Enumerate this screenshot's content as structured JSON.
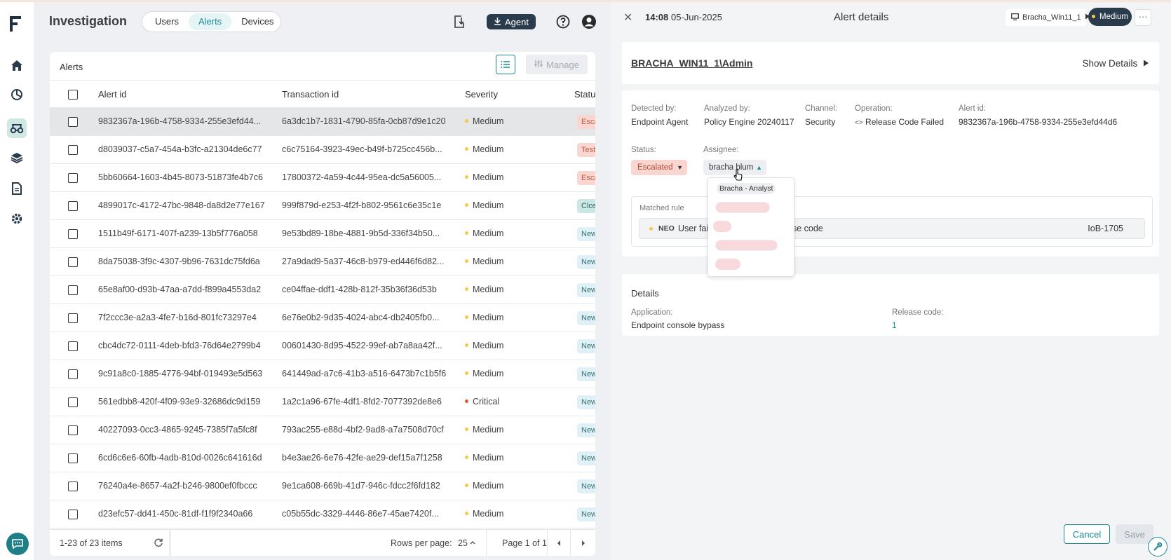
{
  "header": {
    "title": "Investigation",
    "tabs": [
      "Users",
      "Alerts",
      "Devices"
    ],
    "active_tab": "Alerts",
    "agent_label": "Agent"
  },
  "nav": {
    "icons": [
      "logo-icon",
      "home-icon",
      "pie-chart-icon",
      "investigation-icon",
      "layers-icon",
      "document-icon",
      "gear-icon",
      "chat-icon"
    ],
    "active": "investigation-icon"
  },
  "alerts": {
    "title": "Alerts",
    "manage_label": "Manage",
    "columns": [
      "Alert id",
      "Transaction id",
      "Severity",
      "Status"
    ],
    "rows": [
      {
        "alert_id": "9832367a-196b-4758-9334-255e3efd44...",
        "transaction_id": "6a3dc1b7-1831-4790-85fa-0cb87d9e1c20",
        "severity": "Medium",
        "status": "Escalated"
      },
      {
        "alert_id": "d8039037-c5a7-454a-b3fc-a21304de6c77",
        "transaction_id": "c6c75164-3923-49ec-b49f-b725cc456b...",
        "severity": "Medium",
        "status": "Testing"
      },
      {
        "alert_id": "5bb60664-1603-4b45-8073-51873fe4b7c6",
        "transaction_id": "17800372-4a59-4c44-95ea-dc5a56005...",
        "severity": "Medium",
        "status": "Escalated"
      },
      {
        "alert_id": "4899017c-4172-47bc-9848-da8d2e77e167",
        "transaction_id": "999f879d-e253-4f2f-b802-9561c6e35c1e",
        "severity": "Medium",
        "status": "Closed"
      },
      {
        "alert_id": "1511b49f-6171-407f-a239-13b5f776a058",
        "transaction_id": "9e53bd89-18be-4881-9b5d-336f34b50...",
        "severity": "Medium",
        "status": "New"
      },
      {
        "alert_id": "8da75038-3f9c-4307-9b96-7631dc75fd6a",
        "transaction_id": "27a9dad9-5a37-46c8-b979-ed446f6d82...",
        "severity": "Medium",
        "status": "New"
      },
      {
        "alert_id": "65e8af00-d93b-47aa-a7dd-f899a4553da2",
        "transaction_id": "ce04ffae-ddf1-428b-812f-35b36f36d53b",
        "severity": "Medium",
        "status": "New"
      },
      {
        "alert_id": "7f2ccc3e-a2a3-4fe7-b16d-801fc73297e4",
        "transaction_id": "6e76e0b2-9d35-4024-abc4-db2405fb0...",
        "severity": "Medium",
        "status": "New"
      },
      {
        "alert_id": "cbc4dc72-0111-4deb-bfd3-76d64e2799b4",
        "transaction_id": "00601430-8d95-4522-99ef-ab7a8aa42f...",
        "severity": "Medium",
        "status": "New"
      },
      {
        "alert_id": "9c91a8c0-1885-4776-94bf-019493e5d563",
        "transaction_id": "641449ad-a7c6-41b3-a516-6473b7c1b5f6",
        "severity": "Medium",
        "status": "New"
      },
      {
        "alert_id": "561edbb8-420f-4f09-93e9-32686dc9d159",
        "transaction_id": "1a2c1a96-67fe-4df1-8fd2-7077392de8e6",
        "severity": "Critical",
        "status": "New"
      },
      {
        "alert_id": "40227093-0cc3-4865-9245-7385f7a5fc8f",
        "transaction_id": "793ac255-e88d-4bf2-9ad8-a7a7508d70cf",
        "severity": "Medium",
        "status": "New"
      },
      {
        "alert_id": "6cd6c6e6-60fb-4adb-810d-0026c641616d",
        "transaction_id": "b4e3ae26-6e76-42fe-ae29-def15a7f1258",
        "severity": "Medium",
        "status": "New"
      },
      {
        "alert_id": "76240a4e-8657-4a2f-b246-9800ef0fbccc",
        "transaction_id": "9e1ca608-669b-41d7-946c-fdcc2f6fd182",
        "severity": "Medium",
        "status": "New"
      },
      {
        "alert_id": "d23efc57-dd41-450c-81df-f1f9f2340a66",
        "transaction_id": "c05b55dc-3329-4446-86e7-45ae7420f...",
        "severity": "Medium",
        "status": "New"
      }
    ],
    "selected_index": 0,
    "footer": {
      "range": "1-23 of 23 items",
      "rows_per_page_label": "Rows per page:",
      "rows_per_page": "25",
      "page": "Page 1 of 1"
    }
  },
  "detail": {
    "time": "14:08",
    "date": "05-Jun-2025",
    "title": "Alert details",
    "device": "Bracha_Win11_1",
    "severity": "Medium",
    "user": "BRACHA_WIN11_1\\Admin",
    "show_details": "Show Details",
    "fields": {
      "detected_by_label": "Detected by:",
      "detected_by": "Endpoint Agent",
      "analyzed_by_label": "Analyzed by:",
      "analyzed_by": "Policy Engine 20240117",
      "channel_label": "Channel:",
      "channel": "Security",
      "operation_label": "Operation:",
      "operation": "Release Code Failed",
      "alert_id_label": "Alert id:",
      "alert_id": "9832367a-196b-4758-9334-255e3efd44d6"
    },
    "status_label": "Status:",
    "status": "Escalated",
    "assignee_label": "Assignee:",
    "assignee": "bracha blum",
    "dropdown": {
      "first_option": "Bracha - Analyst"
    },
    "matched_rule": {
      "label": "Matched rule",
      "badge": "NEO",
      "text_left": "User fai",
      "text_right": "ase code",
      "rule_id": "IoB-1705"
    },
    "details": {
      "title": "Details",
      "application_label": "Application:",
      "application": "Endpoint console bypass",
      "release_code_label": "Release code:",
      "release_code": "1"
    },
    "cancel_label": "Cancel",
    "save_label": "Save"
  },
  "colors": {
    "accent": "#1d8a93",
    "medium": "#f2c94c",
    "critical": "#e4572e",
    "escalated_bg": "#f9d6cf",
    "new_bg": "#dff1f6",
    "closed_bg": "#cce6e4"
  }
}
